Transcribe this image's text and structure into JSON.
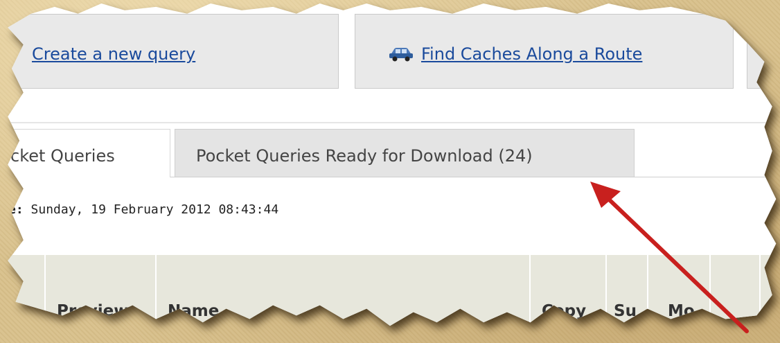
{
  "toolbar": {
    "create_query_label": "Create a new query",
    "route_label": "Find Caches Along a Route",
    "route_icon": "car-icon"
  },
  "tabs": [
    {
      "label": "cket Queries",
      "active": true
    },
    {
      "label": "Pocket Queries Ready for Download (24)",
      "active": false
    }
  ],
  "updated": {
    "prefix": "e:",
    "value": "Sunday, 19 February 2012 08:43:44"
  },
  "table": {
    "columns": [
      "",
      "Preview",
      "Name",
      "Copy",
      "Su",
      "Mo",
      "",
      ""
    ]
  },
  "annotation": {
    "arrow_icon": "red-arrow-icon",
    "arrow_color": "#c8201e"
  },
  "colors": {
    "link": "#1a4a9c",
    "background": "#d9c18c",
    "header_bg": "#e7e7dc"
  }
}
